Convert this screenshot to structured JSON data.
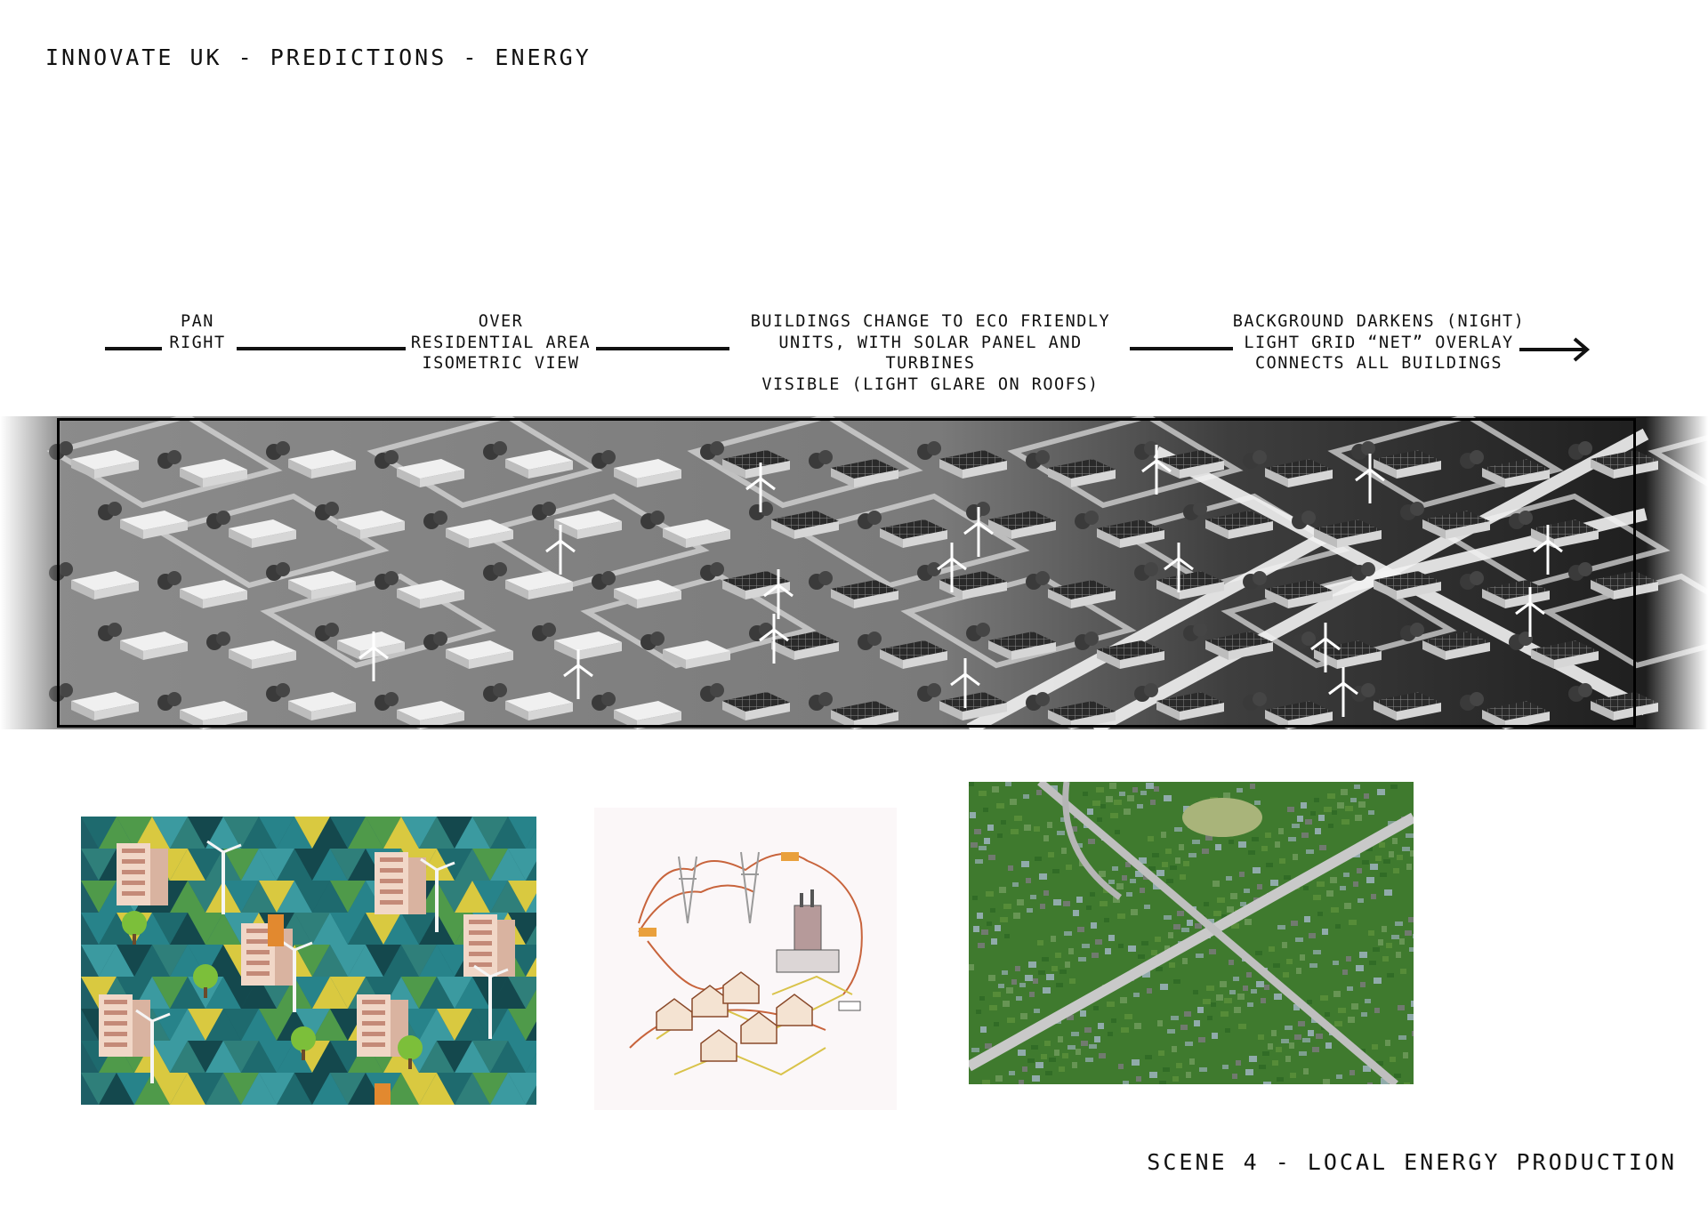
{
  "header": {
    "title": "INNOVATE UK - PREDICTIONS - ENERGY"
  },
  "timeline": {
    "steps": [
      "PAN\nRIGHT",
      "OVER\nRESIDENTIAL AREA\nISOMETRIC VIEW",
      "BUILDINGS CHANGE TO ECO FRIENDLY\nUNITS, WITH SOLAR PANEL AND TURBINES\nVISIBLE (LIGHT GLARE ON ROOFS)",
      "BACKGROUND DARKENS (NIGHT)\nLIGHT GRID “NET” OVERLAY\nCONNECTS ALL BUILDINGS"
    ],
    "arrow_icon": "arrow-right-icon"
  },
  "storyboard": {
    "icons": [
      "house-icon",
      "wind-turbine-icon",
      "solar-panel-icon",
      "tree-icon"
    ]
  },
  "references": {
    "icons": [
      "isometric-city-image",
      "power-grid-diagram-image",
      "aerial-suburb-photo"
    ]
  },
  "footer": {
    "scene_title": "SCENE 4 - LOCAL ENERGY PRODUCTION"
  },
  "colors": {
    "ink": "#111111",
    "teal": "#1e6a6e",
    "foliage": "#3f7a2e",
    "grid_line": "#c8643c"
  }
}
